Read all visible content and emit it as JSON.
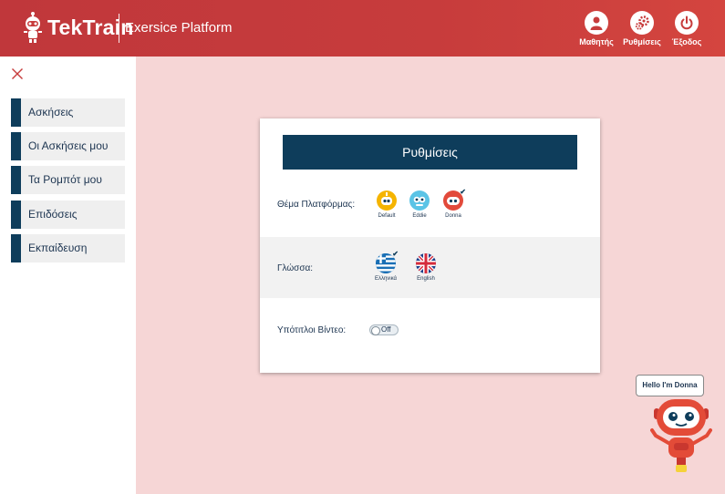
{
  "header": {
    "brand": "TekTrain",
    "subtitle": "Exersice Platform",
    "buttons": [
      {
        "label": "Μαθητής",
        "icon": "user-icon"
      },
      {
        "label": "Ρυθμίσεις",
        "icon": "gears-icon"
      },
      {
        "label": "Έξοδος",
        "icon": "power-icon"
      }
    ]
  },
  "sidebar": {
    "close_icon": "close-icon",
    "items": [
      {
        "label": "Ασκήσεις"
      },
      {
        "label": "Οι Ασκήσεις μου"
      },
      {
        "label": "Τα Ρομπότ μου"
      },
      {
        "label": "Επιδόσεις"
      },
      {
        "label": "Εκπαίδευση"
      }
    ]
  },
  "settings": {
    "title": "Ρυθμίσεις",
    "theme": {
      "label": "Θέμα Πλατφόρμας:",
      "options": [
        {
          "label": "Default",
          "color": "#f5b400"
        },
        {
          "label": "Eddie",
          "color": "#5bc4e6"
        },
        {
          "label": "Donna",
          "color": "#e24a3b",
          "selected": true
        }
      ]
    },
    "language": {
      "label": "Γλώσσα:",
      "options": [
        {
          "label": "Ελληνικά",
          "selected": true
        },
        {
          "label": "English"
        }
      ]
    },
    "subtitles": {
      "label": "Υπότιτλοι Βίντεο:",
      "state": "Off"
    }
  },
  "assistant": {
    "bubble": "Hello I'm Donna"
  },
  "colors": {
    "header": "#c73c3c",
    "accent_navy": "#0e3d5b",
    "background": "#f6d6d6"
  }
}
